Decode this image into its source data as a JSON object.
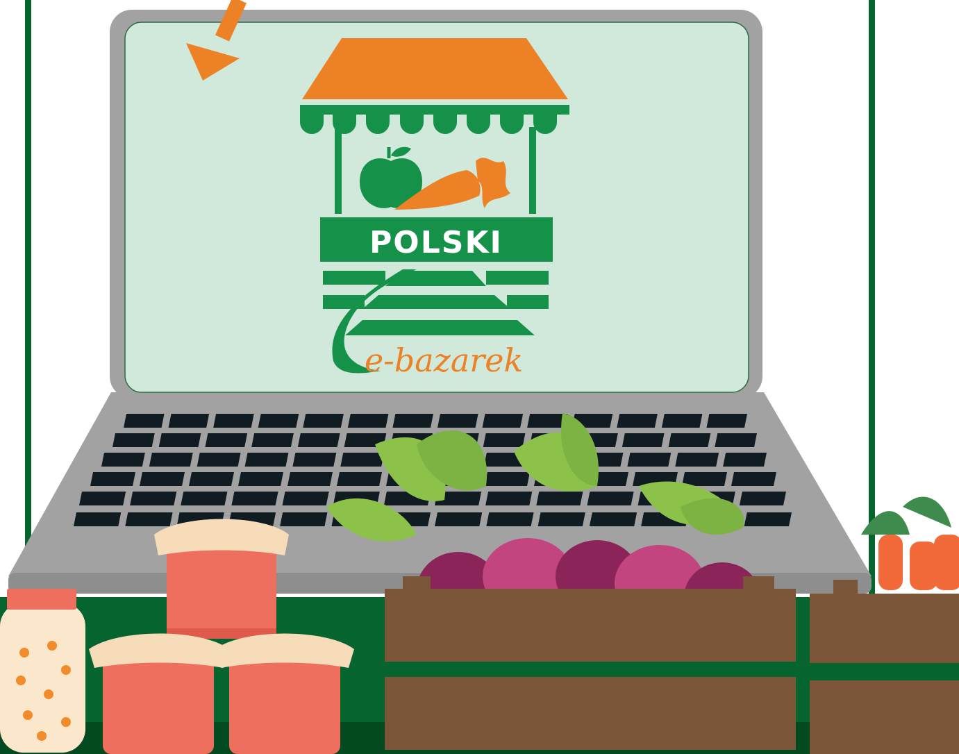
{
  "logo": {
    "word": "POLSKI",
    "script": "e-bazarek",
    "colors": {
      "green": "#16914a",
      "orange": "#ec8125",
      "screen": "#d0e9db"
    }
  },
  "palette": {
    "frame_green": "#06652e",
    "laptop_body": "#a2a2a2",
    "keys": "#101b22",
    "crate_brown": "#7b5538",
    "jar_red": "#ef6f5e",
    "jar_cloth": "#f6dcb8",
    "beet_purple": "#8b2458",
    "beet_pink": "#c3457f",
    "leaf_green": "#8cc24a",
    "carrot_orange": "#f26a3a"
  },
  "icons": [
    "arrow-icon",
    "market-stall-icon",
    "apple-icon",
    "carrot-icon"
  ]
}
